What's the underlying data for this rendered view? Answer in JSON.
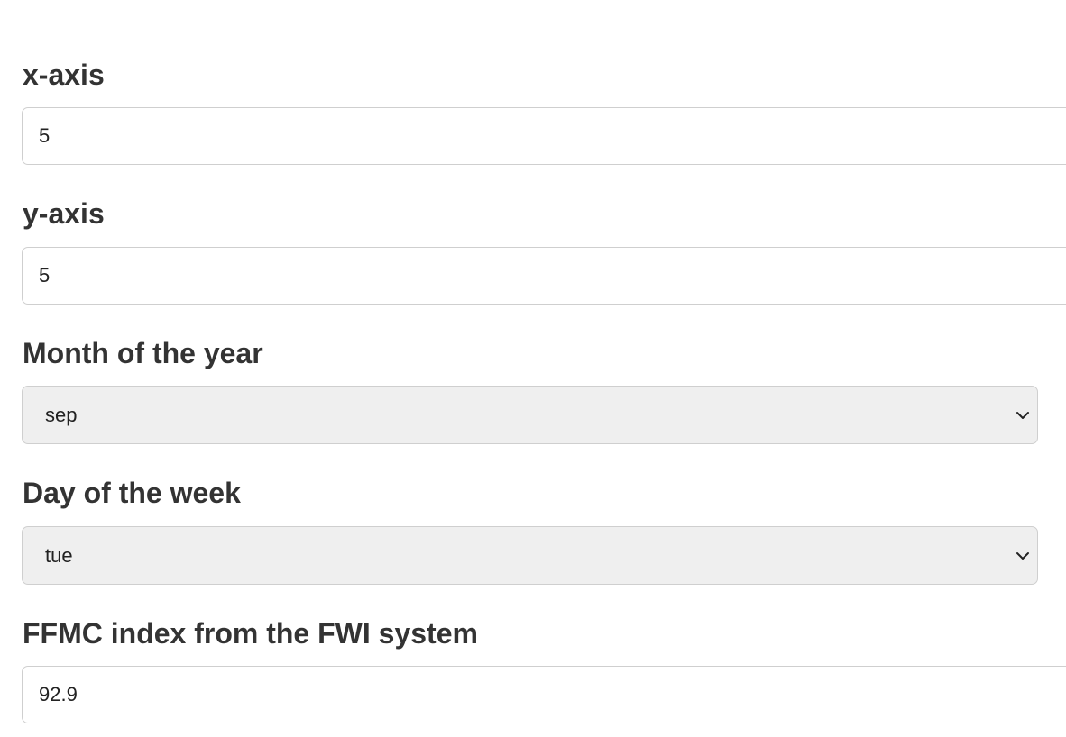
{
  "fields": {
    "x_axis": {
      "label": "x-axis",
      "value": "5"
    },
    "y_axis": {
      "label": "y-axis",
      "value": "5"
    },
    "month": {
      "label": "Month of the year",
      "selected": "sep",
      "icon": "chevron-down-icon"
    },
    "day": {
      "label": "Day of the week",
      "selected": "tue",
      "icon": "chevron-down-icon"
    },
    "ffmc": {
      "label": "FFMC index from the FWI system",
      "value": "92.9"
    }
  }
}
